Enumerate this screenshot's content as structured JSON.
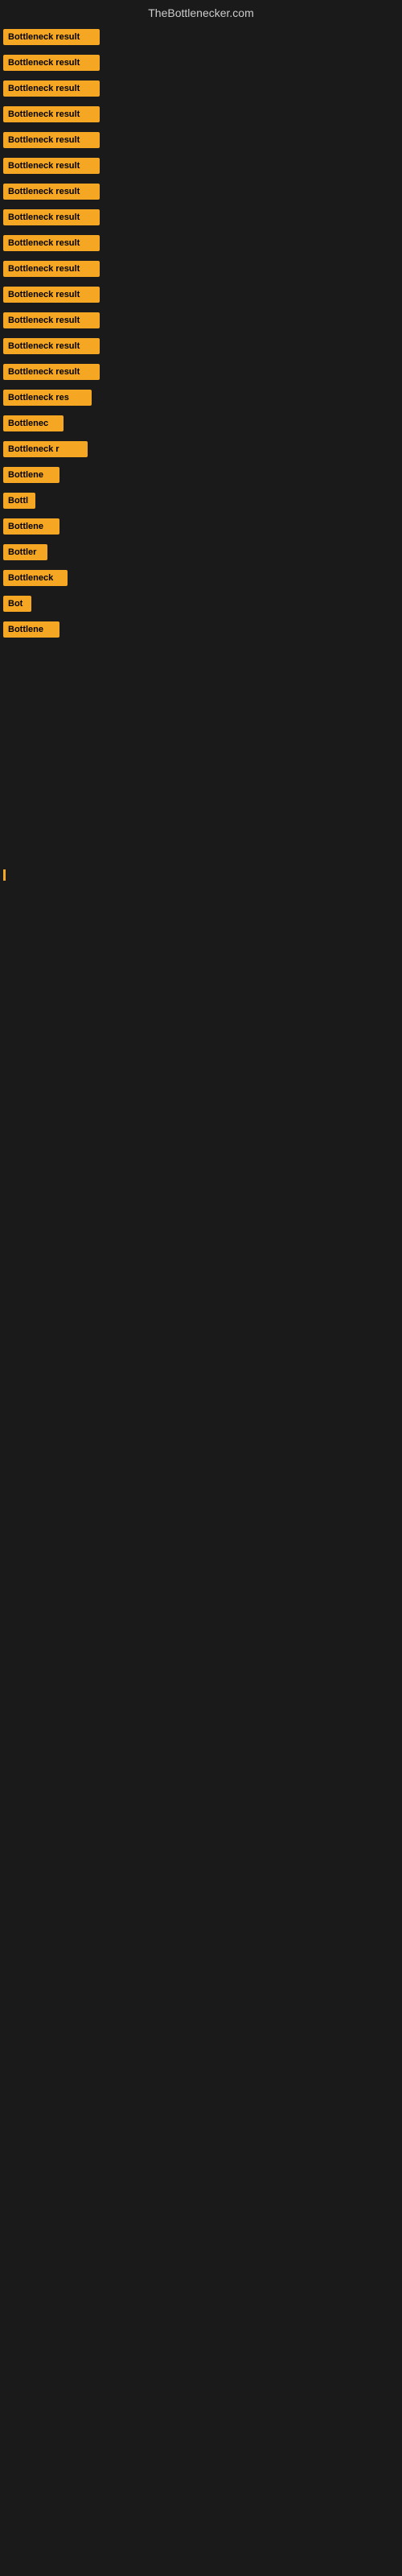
{
  "site": {
    "title": "TheBottlenecker.com"
  },
  "colors": {
    "badge_bg": "#f5a623",
    "badge_text": "#000000",
    "page_bg": "#1a1a1a",
    "header_text": "#cccccc"
  },
  "items": [
    {
      "id": 1,
      "label": "Bottleneck result"
    },
    {
      "id": 2,
      "label": "Bottleneck result"
    },
    {
      "id": 3,
      "label": "Bottleneck result"
    },
    {
      "id": 4,
      "label": "Bottleneck result"
    },
    {
      "id": 5,
      "label": "Bottleneck result"
    },
    {
      "id": 6,
      "label": "Bottleneck result"
    },
    {
      "id": 7,
      "label": "Bottleneck result"
    },
    {
      "id": 8,
      "label": "Bottleneck result"
    },
    {
      "id": 9,
      "label": "Bottleneck result"
    },
    {
      "id": 10,
      "label": "Bottleneck result"
    },
    {
      "id": 11,
      "label": "Bottleneck result"
    },
    {
      "id": 12,
      "label": "Bottleneck result"
    },
    {
      "id": 13,
      "label": "Bottleneck result"
    },
    {
      "id": 14,
      "label": "Bottleneck result"
    },
    {
      "id": 15,
      "label": "Bottleneck res"
    },
    {
      "id": 16,
      "label": "Bottlenec"
    },
    {
      "id": 17,
      "label": "Bottleneck r"
    },
    {
      "id": 18,
      "label": "Bottlene"
    },
    {
      "id": 19,
      "label": "Bottl"
    },
    {
      "id": 20,
      "label": "Bottlene"
    },
    {
      "id": 21,
      "label": "Bottler"
    },
    {
      "id": 22,
      "label": "Bottleneck"
    },
    {
      "id": 23,
      "label": "Bot"
    },
    {
      "id": 24,
      "label": "Bottlene"
    }
  ]
}
